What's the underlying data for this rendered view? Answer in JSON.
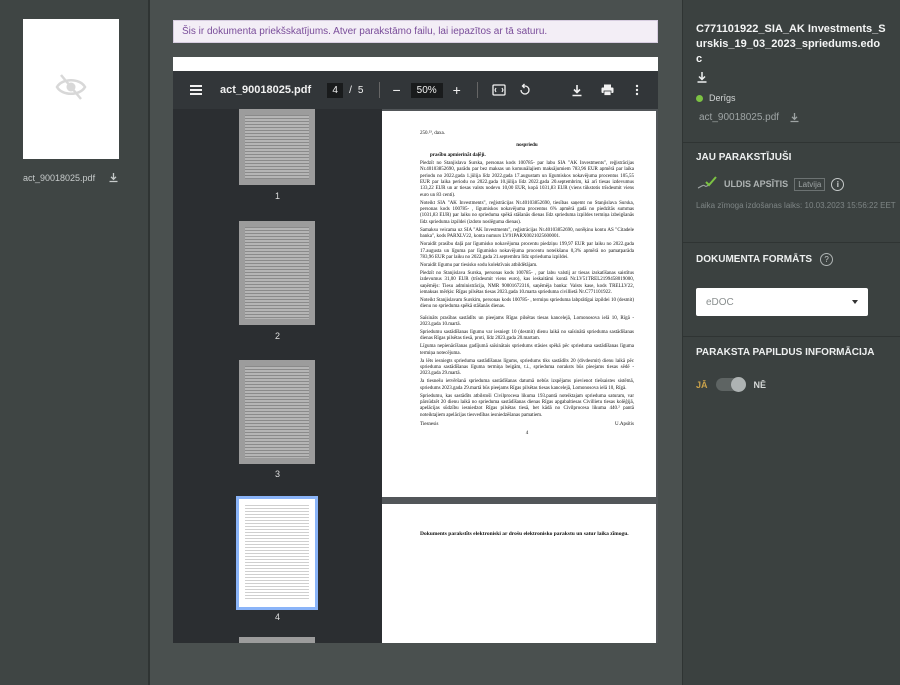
{
  "left_file": {
    "name": "act_90018025.pdf",
    "preview_icon": "eye-off-icon",
    "download_icon": "download-icon"
  },
  "notice": {
    "text": "Šis ir dokumenta priekšskatījums. Atver parakstāmo failu, lai iepazītos ar tā saturu."
  },
  "viewer": {
    "title": "act_90018025.pdf",
    "current_page": "4",
    "page_separator": "/",
    "total_pages": "5",
    "zoom_minus": "−",
    "zoom": "50%",
    "zoom_plus": "+",
    "thumbnails": [
      {
        "label": "1",
        "active": false
      },
      {
        "label": "2",
        "active": false
      },
      {
        "label": "3",
        "active": false
      },
      {
        "label": "4",
        "active": true
      }
    ],
    "page4": {
      "top_line": "250.²³, daxa.",
      "heading": "nospriedu",
      "subheading": "prasību apmierināt daļēji.",
      "paragraphs": [
        "Piedzīt no Stanjislava Surska, personas kods 100785- par labu SIA \"AK Investments\", reģistrācijas Nr.40103852690, parādu par bez maksas un komunālajiem maksājumiem 783,96 EUR apmērā par laika periodu no 2022.gada 1.jūlija līdz 2022.gada 17.augustam un līgumiskos nokavējuma procentus 105,55 EUR par laika periodu no 2022.gada 10.jūlija līdz 2022.gada 20.septembrim, kā arī tiesas izdevumus 133,22 EUR un ar tiesas valsts nodevu 10,00 EUR, kopā 1031,83 EUR (viens tūkstotis trīsdesmit viens euro un 83 centi).",
        "Noteikt SIA \"AK Investments\", reģistrācijas Nr.40103852690, tiesības saņemt no Stanjislava Surska, personas kods 100785- , līgumiskos nokavējuma procentus 6% apmērā gadā no piedzītās summas (1031,83 EUR) par laiku no sprieduma spēkā stāšanās dienas līdz sprieduma izpildes termiņa izbeigšanās līdz sprieduma izpildei (izdoto noslēguma dienas).",
        "Samaksu veicama uz SIA \"AK Investments\", reģistrācijas Nr.40103852690, norēķinu kontu AS \"Citadele banka\", kods PARXLV22, konta numurs LV91PARX0021025600001.",
        "Noraidīt prasību daļā par līgumisko nokavējuma procentu piedziņu 199,97 EUR par laiku no 2022.gada 17.augusta un līguma par līgumisko nokavējuma procentu noteikšanu 0,3% apmērā no pamatparāda 783,96 EUR par laiku no 2022.gada 21.septembra līdz sprieduma izpildei.",
        "Noraidīt līgumu par tiesisko sodu kolektīvais atbildētājam.",
        "Piedzīt no Stanjislava Surska, personas kods 100785- , par labu valstij ar tiesas izskatīšanas saistītus izdevumus 31,00 EUR (trīsdesmit viens euro), kas ieskaitāmi kontā Nr.LV51TREL2199458019000, saņēmējs: Tiesu administrācija, NMR 90001672316, saņēmēja banka: Valsts kase, kods TRELLV22, iemaksas mērķis: Rīgas pilsētas tiesas 2023.gada 10.marta sprieduma civillietā Nr.C771101922.",
        "Noteikt Stanjislavam Surskim, personas kods 100785- , termiņu sprieduma labprātīgai izpildei 10 (desmit) dienu no sprieduma spēkā stāšanās dienas.",
        "Saīsināts prasības sastādīts un pieejams Rīgas pilsētas tiesas kancelejā, Lomonosova ielā 10, Rīgā - 2023.gada 10.martā.",
        "Spriedumu sastādīšanas līgumu var iesniegt 10 (desmit) dienu laikā no saīsinātā sprieduma sastādīšanas dienas Rīgas pilsētas tiesā, proti, līdz 2023.gada 20.martam.",
        "Līguma nepienācīšanas gadījumā saīsinātais spriedums stāsies spēkā pēc sprieduma sastādīšanas līguma termiņa notecējuma.",
        "Ja lēts iesniegts sprieduma sastādīšanas līgums, spriedums tiks sastādīts 20 (divdesmit) dienu laikā pēc sprieduma sastādīšanas līguma termiņa beigām, t.i., sprieduma noraksts būs pieejams tiesas sēdē - 2023.gada 29.martā.",
        "Ja tiesnešu ietvēršanā sprieduma sastādīšanas datumā nebūs izspējams pievienot tiešsaistes sistēmā, spriedums 2023.gada 29.martā būs pieejams Rīgas pilsētas tiesas kancelejā, Lomonosova ielā 10, Rīgā.",
        "Spriedumu, kas sastādīts atbilstoši Civilprocesa likuma 193.pantā noteiktajam sprieduma saturam, var pārsūdzēt 20 dienu laikā no sprieduma sastādīšanas dienas Rīgas apgabaltiesas Civillietu tiesas kolēģijā, apelācijas sūdzību iesniedzot Rīgas pilsētas tiesā, bet kādā no Civilprocesa likuma 440.² pantā noteiktajiem apelācijas tiesvedības iesniedzēšanas pamatiem."
      ],
      "signature_left": "Tiesnesis",
      "signature_right": "U.Apsītis",
      "page_number": "4"
    },
    "page5": {
      "text": "Dokuments parakstīts elektroniski ar drošu elektronisko parakstu un satur laika zīmogu."
    }
  },
  "right_panel": {
    "doc_title": "C771101922_SIA_AK Investments_Surskis_19_03_2023_spriedums.edoc",
    "status": "Derīgs",
    "status_color": "#7cc243",
    "file_name": "act_90018025.pdf",
    "signed_heading": "JAU PARAKSTĪJUŠI",
    "signer_name": "ULDIS APSĪTIS",
    "signer_country": "Latvija",
    "sign_time": "Laika zīmoga izdošanas laiks: 10.03.2023 15:56:22 EET",
    "format_heading": "DOKUMENTA FORMĀTS",
    "format_value": "eDOC",
    "extra_heading": "PARAKSTA PAPILDUS INFORMĀCIJA",
    "toggle_yes": "JĀ",
    "toggle_no": "NĒ"
  }
}
